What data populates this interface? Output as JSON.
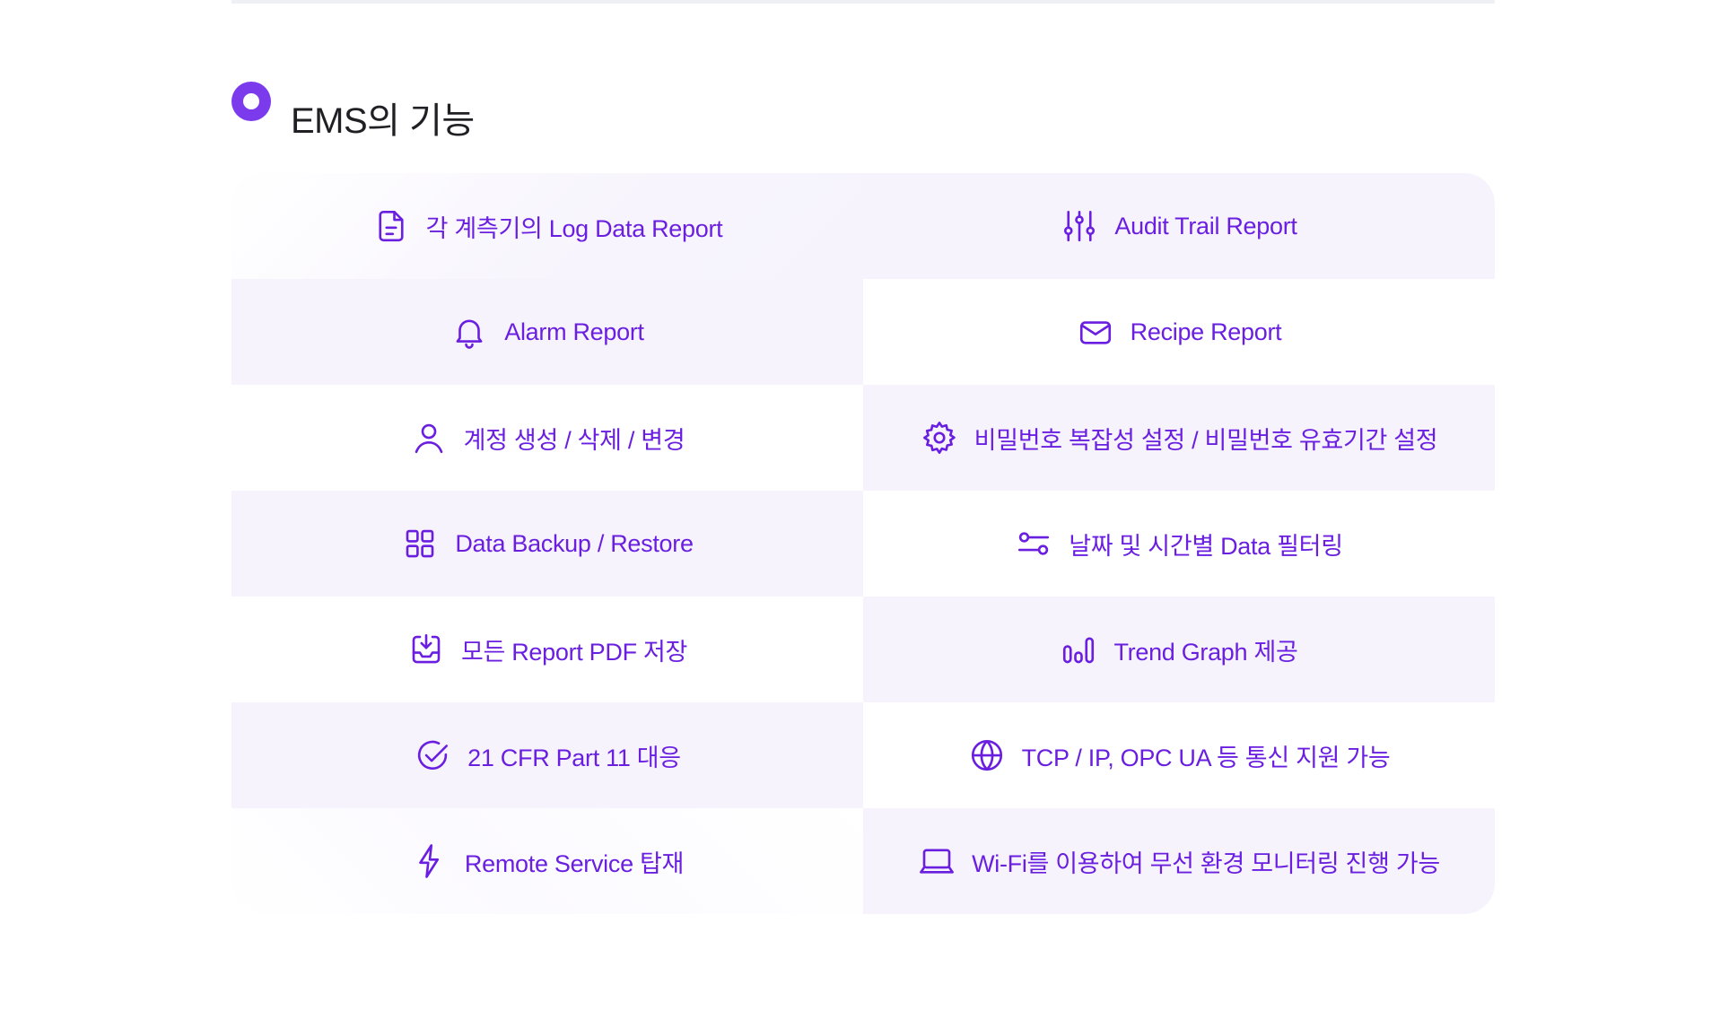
{
  "section": {
    "title": "EMS의 기능"
  },
  "features": [
    {
      "label": "각 계측기의 Log Data Report",
      "icon": "document-icon"
    },
    {
      "label": "Audit Trail Report",
      "icon": "sliders-icon"
    },
    {
      "label": "Alarm Report",
      "icon": "bell-icon"
    },
    {
      "label": "Recipe Report",
      "icon": "mail-icon"
    },
    {
      "label": "계정 생성 / 삭제 / 변경",
      "icon": "user-icon"
    },
    {
      "label": "비밀번호 복잡성 설정 / 비밀번호 유효기간 설정",
      "icon": "gear-icon"
    },
    {
      "label": "Data Backup / Restore",
      "icon": "grid-icon"
    },
    {
      "label": "날짜 및 시간별 Data 필터링",
      "icon": "filter-toggle-icon"
    },
    {
      "label": "모든 Report PDF 저장",
      "icon": "inbox-download-icon"
    },
    {
      "label": "Trend Graph 제공",
      "icon": "bar-graph-icon"
    },
    {
      "label": "21 CFR Part 11 대응",
      "icon": "check-circle-icon"
    },
    {
      "label": "TCP / IP, OPC UA 등 통신 지원 가능",
      "icon": "globe-icon"
    },
    {
      "label": "Remote Service 탑재",
      "icon": "lightning-icon"
    },
    {
      "label": "Wi-Fi를 이용하여 무선 환경 모니터링 진행 가능",
      "icon": "laptop-icon"
    }
  ],
  "colors": {
    "accent": "#7c3aed",
    "text_accent": "#6a1fe0",
    "cell_shade": "#f6f3fd",
    "title_text": "#1f1f24"
  }
}
